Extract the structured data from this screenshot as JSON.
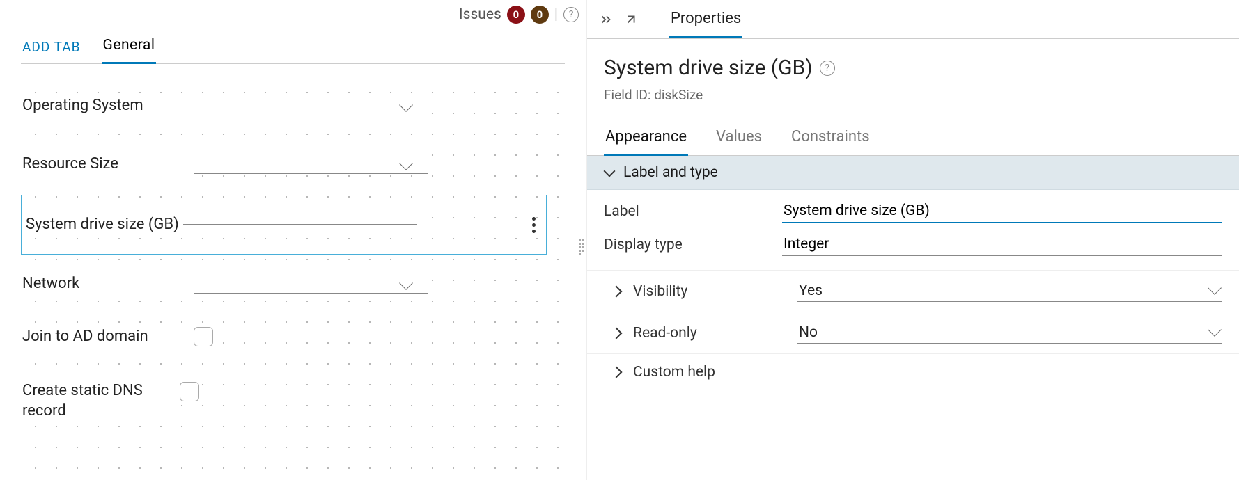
{
  "issues": {
    "label": "Issues",
    "count_red": "0",
    "count_brown": "0"
  },
  "left_tabs": {
    "add": "ADD TAB",
    "general": "General"
  },
  "fields": {
    "os": {
      "label": "Operating System"
    },
    "resource_size": {
      "label": "Resource Size"
    },
    "disk_size": {
      "label": "System drive size (GB)"
    },
    "network": {
      "label": "Network"
    },
    "join_ad": {
      "label": "Join to AD domain"
    },
    "static_dns": {
      "label": "Create static DNS record"
    }
  },
  "right": {
    "header_tab": "Properties",
    "title": "System drive size (GB)",
    "field_id_label": "Field ID: diskSize",
    "tabs": {
      "appearance": "Appearance",
      "values": "Values",
      "constraints": "Constraints"
    },
    "section_label_type": "Label and type",
    "rows": {
      "label": {
        "name": "Label",
        "value": "System drive size (GB)"
      },
      "display_type": {
        "name": "Display type",
        "value": "Integer"
      },
      "visibility": {
        "name": "Visibility",
        "value": "Yes"
      },
      "read_only": {
        "name": "Read-only",
        "value": "No"
      },
      "custom_help": {
        "name": "Custom help"
      }
    }
  }
}
